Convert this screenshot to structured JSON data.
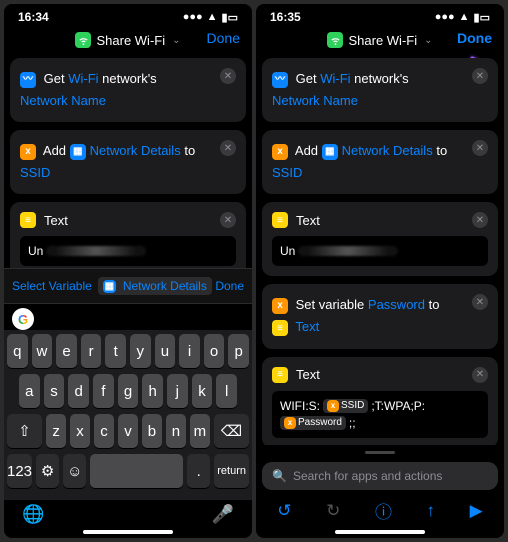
{
  "statusbar": {
    "time": "16:34",
    "time2": "16:35"
  },
  "header": {
    "title": "Share Wi-Fi",
    "done": "Done"
  },
  "action_get": {
    "pre": "Get",
    "var": "Wi-Fi",
    "mid": "network's",
    "target": "Network Name"
  },
  "action_add": {
    "pre": "Add",
    "var": "Network Details",
    "mid": "to",
    "target": "SSID"
  },
  "action_text": {
    "label": "Text",
    "value_prefix": "Un"
  },
  "keyboard_suggest": {
    "select_variable": "Select Variable",
    "tag": "Network Details",
    "done": "Done"
  },
  "action_setvar": {
    "pre": "Set variable",
    "var": "Password",
    "mid": "to",
    "target": "Text"
  },
  "action_text2": {
    "label": "Text",
    "prefix": "WIFI:S:",
    "chip1": "SSID",
    "mid": ";T:WPA;P:",
    "chip2": "Password",
    "suffix": ";;"
  },
  "search": {
    "placeholder": "Search for apps and actions"
  },
  "keys": {
    "row1": [
      "q",
      "w",
      "e",
      "r",
      "t",
      "y",
      "u",
      "i",
      "o",
      "p"
    ],
    "row2": [
      "a",
      "s",
      "d",
      "f",
      "g",
      "h",
      "j",
      "k",
      "l"
    ],
    "row3": [
      "z",
      "x",
      "c",
      "v",
      "b",
      "n",
      "m"
    ],
    "num": "123",
    "space": "space",
    "return": "return"
  }
}
